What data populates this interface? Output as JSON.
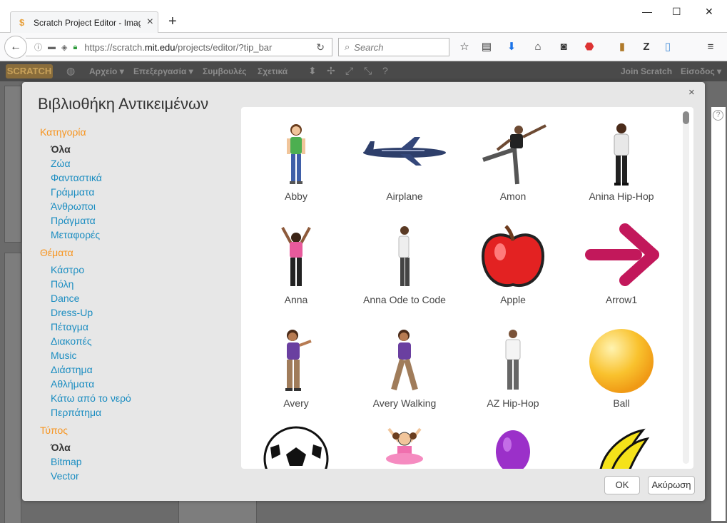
{
  "browser": {
    "tab_title": "Scratch Project Editor - Imag",
    "tab_close": "×",
    "new_tab": "+",
    "win_min": "—",
    "win_max": "☐",
    "win_close": "✕",
    "url_host": "https://scratch.",
    "url_domain": "mit.edu",
    "url_path": "/projects/editor/?tip_bar",
    "search_placeholder": "Search"
  },
  "scratch_menu": {
    "logo": "SCRATCH",
    "file": "Αρχείο ▾",
    "edit": "Επεξεργασία ▾",
    "tips": "Συμβουλές",
    "about": "Σχετικά",
    "join": "Join Scratch",
    "signin": "Είσοδος ▾"
  },
  "modal": {
    "title": "Βιβλιοθήκη Αντικειμένων",
    "close": "×",
    "ok": "OK",
    "cancel": "Ακύρωση"
  },
  "sidebar": {
    "category_header": "Κατηγορία",
    "categories": [
      "Όλα",
      "Ζώα",
      "Φανταστικά",
      "Γράμματα",
      "Άνθρωποι",
      "Πράγματα",
      "Μεταφορές"
    ],
    "themes_header": "Θέματα",
    "themes": [
      "Κάστρο",
      "Πόλη",
      "Dance",
      "Dress-Up",
      "Πέταγμα",
      "Διακοπές",
      "Music",
      "Διάστημα",
      "Αθλήματα",
      "Κάτω από το νερό",
      "Περπάτημα"
    ],
    "type_header": "Τύπος",
    "types": [
      "Όλα",
      "Bitmap",
      "Vector"
    ]
  },
  "sprites": [
    "Abby",
    "Airplane",
    "Amon",
    "Anina Hip-Hop",
    "Anna",
    "Anna Ode to Code",
    "Apple",
    "Arrow1",
    "Avery",
    "Avery Walking",
    "AZ Hip-Hop",
    "Ball"
  ],
  "colors": {
    "accent_orange": "#f7941e",
    "link_blue": "#1b8dc1",
    "apple_red": "#e32222",
    "arrow_pink": "#c2185b",
    "ball_yellow": "#f9c22e"
  }
}
